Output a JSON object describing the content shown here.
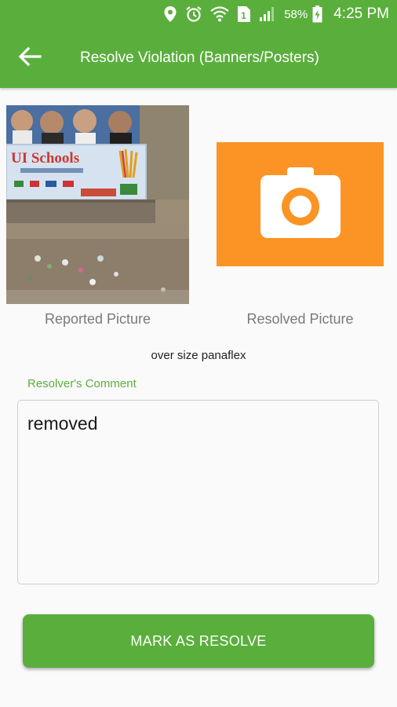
{
  "status_bar": {
    "battery_percent": "58%",
    "time": "4:25 PM",
    "sim_slot": "1",
    "icons": [
      "location-icon",
      "alarm-icon",
      "wifi-icon",
      "sim-icon",
      "signal-icon",
      "battery-charging-icon"
    ]
  },
  "toolbar": {
    "back_icon": "arrow-left-icon",
    "title": "Resolve Violation (Banners/Posters)"
  },
  "photos": {
    "reported_label": "Reported Picture",
    "resolved_label": "Resolved Picture",
    "banner_text": "UI Schools",
    "resolved_icon": "camera-icon"
  },
  "violation": {
    "description": "over size panaflex"
  },
  "comment": {
    "label": "Resolver's Comment",
    "value": "removed"
  },
  "actions": {
    "resolve_label": "MARK AS RESOLVE"
  },
  "colors": {
    "primary": "#5aaf3c",
    "accent_orange": "#fb9424"
  }
}
